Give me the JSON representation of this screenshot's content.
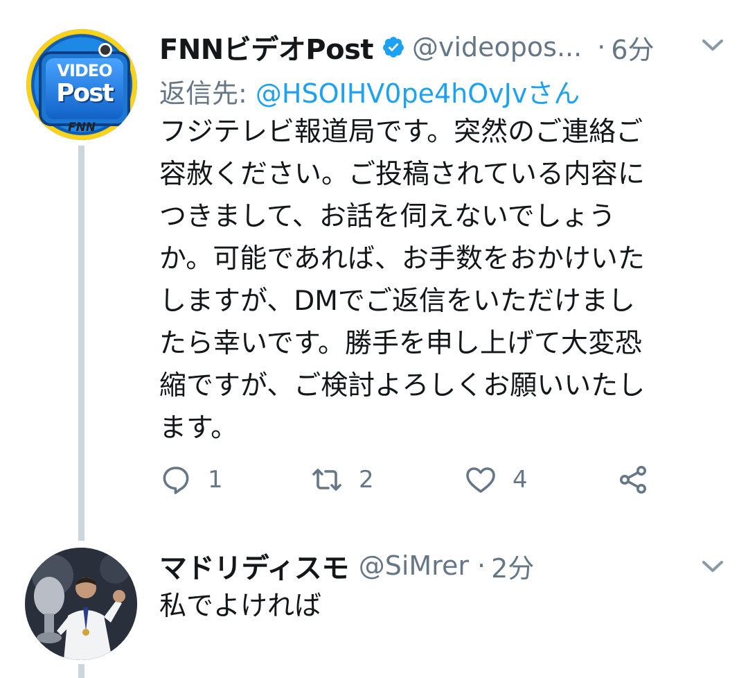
{
  "tweet1": {
    "display_name": "FNNビデオPost",
    "handle": "@videopos...",
    "dot": "·",
    "time": "6分",
    "reply_prefix": "返信先: ",
    "reply_handle": "@HSOIHV0pe4hOvJvさん",
    "avatar_text": {
      "video": "VIDEO",
      "post": "Post",
      "fnn": "FNN"
    },
    "text_lines": [
      "フジテレビ報道局です。突然のご連絡ご",
      "容赦ください。ご投稿されている内容に",
      "つきまして、お話を伺えないでしょう",
      "か。可能であれば、お手数をおかけいた",
      "しますが、DMでご返信をいただけまし",
      "たら幸いです。勝手を申し上げて大変恐",
      "縮ですが、ご検討よろしくお願いいたし",
      "ます。"
    ],
    "actions": {
      "reply_count": "1",
      "retweet_count": "2",
      "like_count": "4"
    }
  },
  "tweet2": {
    "display_name": "マドリディスモ",
    "handle": "@SiMrer",
    "dot": "·",
    "time": "2分",
    "text": "私でよければ"
  },
  "colors": {
    "text": "#14171a",
    "secondary": "#657786",
    "link": "#1da1f2",
    "thread": "#ccd6dd"
  }
}
